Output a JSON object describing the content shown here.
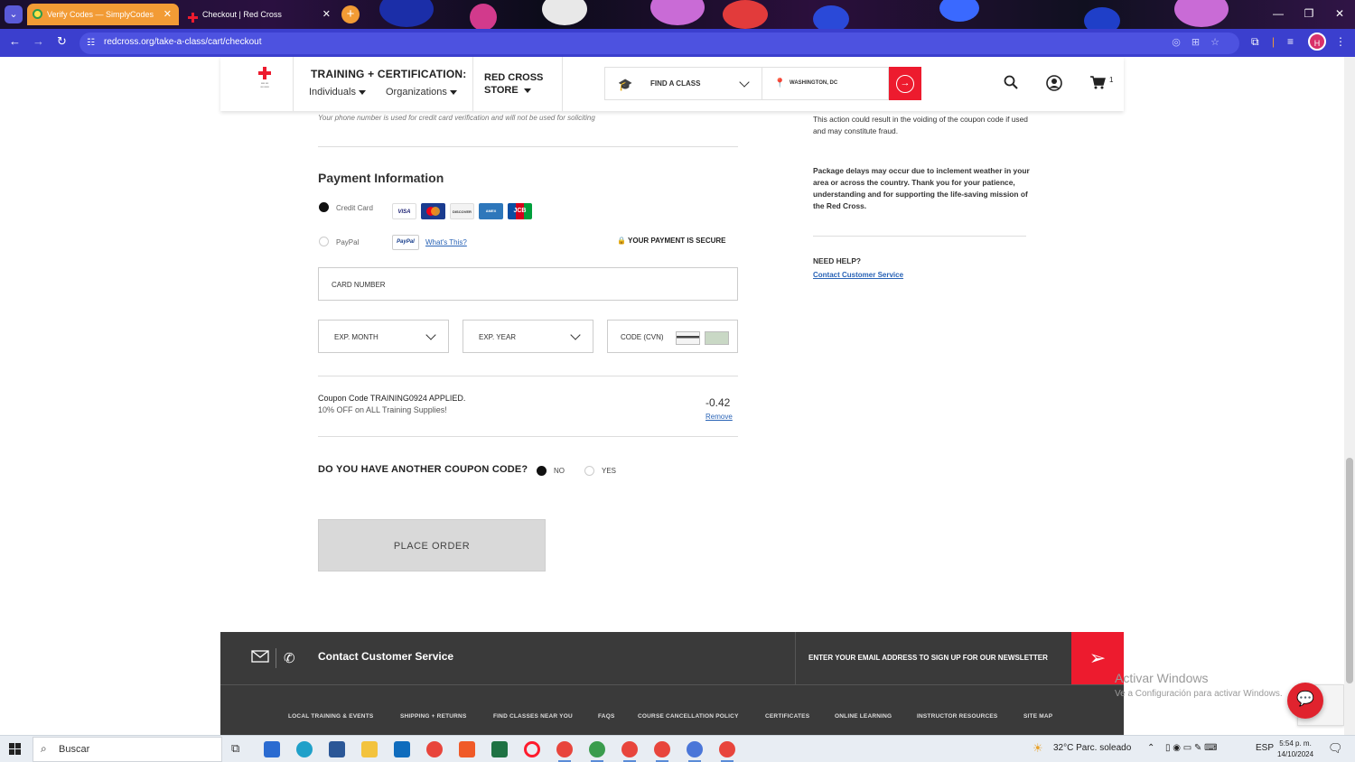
{
  "browser": {
    "tabs": [
      {
        "title": "Verify Codes — SimplyCodes",
        "active": false
      },
      {
        "title": "Checkout | Red Cross",
        "active": true
      }
    ],
    "url": "redcross.org/take-a-class/cart/checkout",
    "profile_initial": "H"
  },
  "header": {
    "training_title": "TRAINING + CERTIFICATION:",
    "individuals": "Individuals",
    "organizations": "Organizations",
    "store_line1": "RED CROSS",
    "store_line2": "STORE",
    "find_class": "FIND A CLASS",
    "location": "WASHINGTON, DC",
    "cart_count": "1"
  },
  "checkout": {
    "phone_note": "Your phone number is used for credit card verification and will not be used for soliciting",
    "payment_title": "Payment Information",
    "credit_card_label": "Credit Card",
    "paypal_label": "PayPal",
    "whats_this": "What's This?",
    "secure_label": "YOUR PAYMENT IS SECURE",
    "card_logos": [
      "VISA",
      "MC",
      "DISCOVER",
      "AMEX",
      "JCB"
    ],
    "card_number_label": "CARD NUMBER",
    "exp_month_label": "EXP. MONTH",
    "exp_year_label": "EXP. YEAR",
    "cvn_label": "CODE (CVN)",
    "coupon_line1": "Coupon Code TRAINING0924 APPLIED.",
    "coupon_line2": "10% OFF on ALL Training Supplies!",
    "coupon_amount": "-0.42",
    "remove_label": "Remove",
    "another_coupon_question": "DO YOU HAVE ANOTHER COUPON CODE?",
    "no_label": "NO",
    "yes_label": "YES",
    "place_order": "PLACE ORDER",
    "payment_method": "Credit Card",
    "another_coupon_value": "NO"
  },
  "sidebar": {
    "fraud_text": "This action could result in the voiding of the coupon code if used and may constitute fraud.",
    "delay_text": "Package delays may occur due to inclement weather in your area or across the country. Thank you for your patience, understanding and for supporting the life-saving mission of the Red Cross.",
    "need_help": "NEED HELP?",
    "contact_link": "Contact Customer Service"
  },
  "footer": {
    "contact": "Contact Customer Service",
    "newsletter": "ENTER YOUR EMAIL ADDRESS TO SIGN UP FOR OUR NEWSLETTER",
    "links": [
      "LOCAL TRAINING & EVENTS",
      "SHIPPING + RETURNS",
      "FIND CLASSES NEAR YOU",
      "FAQS",
      "COURSE CANCELLATION POLICY",
      "CERTIFICATES",
      "ONLINE LEARNING",
      "INSTRUCTOR RESOURCES",
      "SITE MAP"
    ]
  },
  "overlay": {
    "watermark_line1": "Activar Windows",
    "watermark_line2": "Ve a Configuración para activar Windows."
  },
  "taskbar": {
    "search_placeholder": "Buscar",
    "weather": "32°C  Parc. soleado",
    "lang": "ESP",
    "time": "5:54 p. m.",
    "date": "14/10/2024"
  },
  "colors": {
    "brand_red": "#ed1b2e",
    "link_blue": "#2963b6",
    "browser_bar": "#3b3fce"
  }
}
